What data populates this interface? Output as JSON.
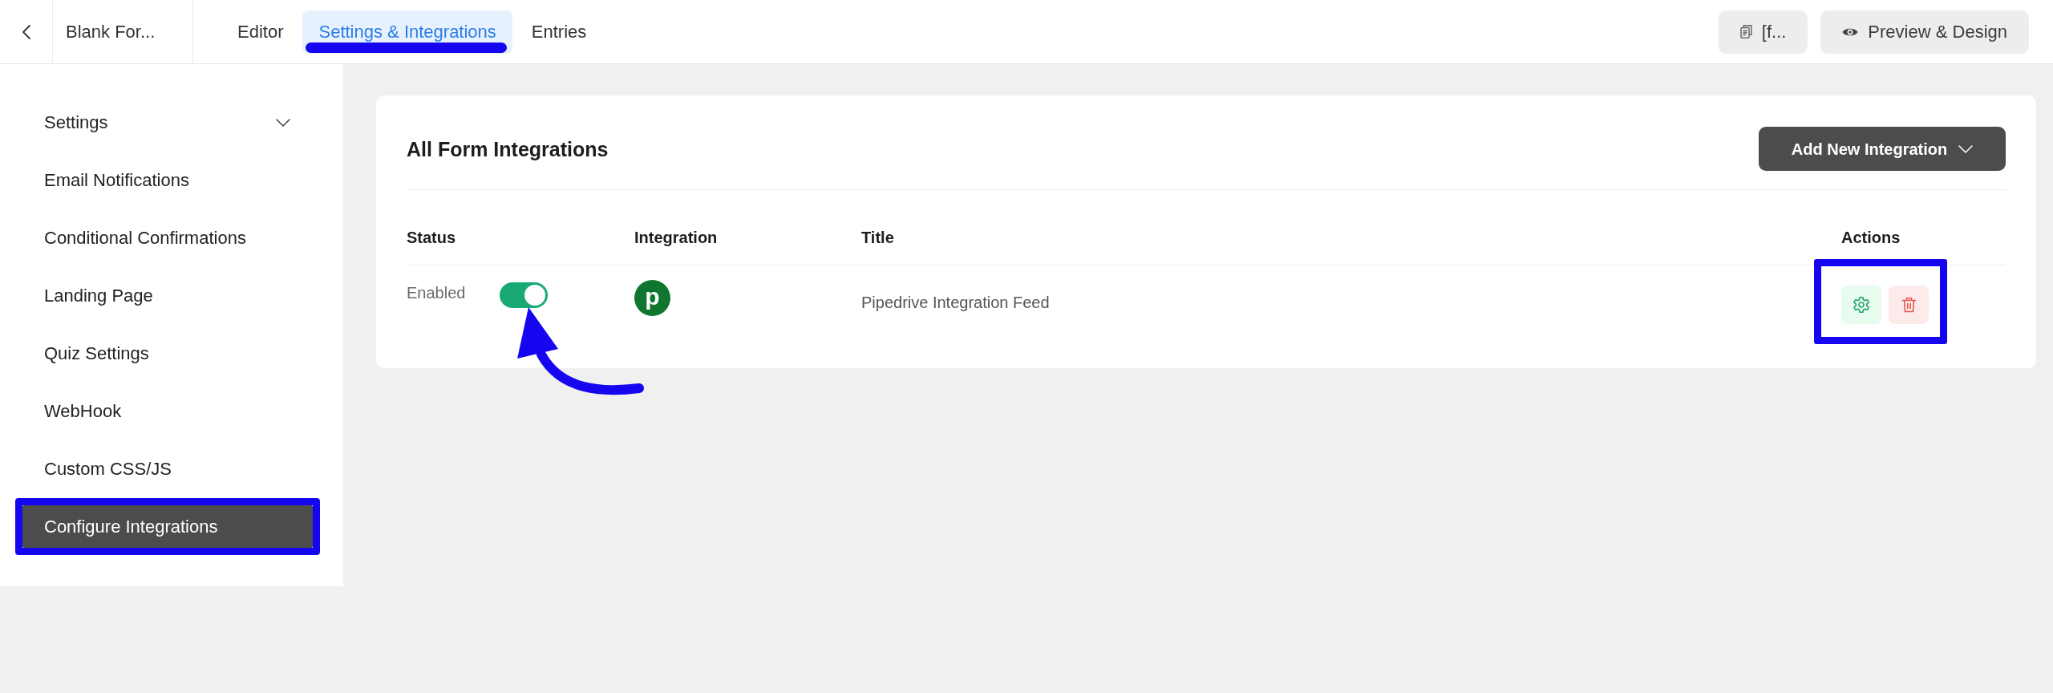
{
  "header": {
    "form_name": "Blank For...",
    "tabs": [
      {
        "label": "Editor",
        "selected": false
      },
      {
        "label": "Settings & Integrations",
        "selected": true
      },
      {
        "label": "Entries",
        "selected": false
      }
    ],
    "buttons": [
      {
        "kind": "shortcode",
        "label": "[f..."
      },
      {
        "kind": "preview",
        "label": "Preview & Design"
      }
    ]
  },
  "sidebar": {
    "items": [
      {
        "label": "Settings",
        "kind": "menu",
        "selected": false
      },
      {
        "label": "Email Notifications",
        "kind": "link",
        "selected": false
      },
      {
        "label": "Conditional Confirmations",
        "kind": "link",
        "selected": false
      },
      {
        "label": "Landing Page",
        "kind": "link",
        "selected": false
      },
      {
        "label": "Quiz Settings",
        "kind": "link",
        "selected": false
      },
      {
        "label": "WebHook",
        "kind": "link",
        "selected": false
      },
      {
        "label": "Custom CSS/JS",
        "kind": "link",
        "selected": false
      },
      {
        "label": "Configure Integrations",
        "kind": "link",
        "selected": true
      }
    ]
  },
  "panel": {
    "title": "All Form Integrations",
    "add_button": "Add New Integration",
    "columns": [
      "Status",
      "Integration",
      "Title",
      "Actions"
    ],
    "rows": [
      {
        "status": "Enabled",
        "enabled": true,
        "logo": "p",
        "title": "Pipedrive Integration Feed"
      }
    ]
  }
}
